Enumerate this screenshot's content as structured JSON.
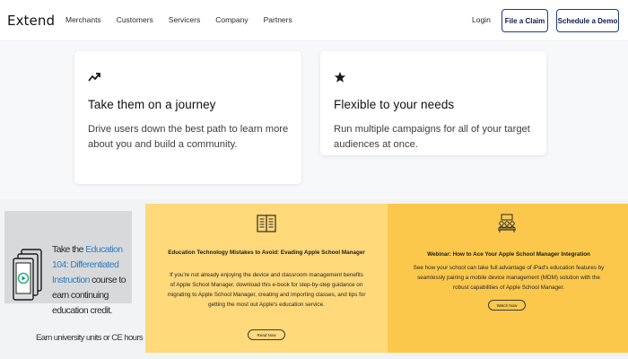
{
  "header": {
    "logo": "Extend",
    "nav": [
      "Merchants",
      "Customers",
      "Servicers",
      "Company",
      "Partners"
    ],
    "login": "Login",
    "file_claim": "File a Claim",
    "schedule_demo": "Schedule a Demo"
  },
  "cards": [
    {
      "icon": "trending-up-icon",
      "title": "Take them on a journey",
      "body": "Drive users down the best path to learn more about you and build a community."
    },
    {
      "icon": "star-icon",
      "title": "Flexible to your needs",
      "body": "Run multiple campaigns for all of your target audiences at once."
    }
  ],
  "promo": {
    "prefix": "Take the ",
    "highlight": "Education 104: Differentiated Instruction",
    "suffix": " course to earn continuing education credit.",
    "credits": "Earn university units or CE hours"
  },
  "panels": [
    {
      "icon": "book-icon",
      "title": "Education Technology Mistakes to Avoid: Evading Apple School Manager",
      "body": "If you're not already enjoying the device and classroom management benefits of Apple School Manager, download this e-book for step-by-step guidance on migrating to Apple School Manager, creating and importing classes, and tips for getting the most out Apple's education service.",
      "button": "Read Now"
    },
    {
      "icon": "classroom-icon",
      "title": "Webinar: How to Ace Your Apple School Manager Integration",
      "body": "See how your school can take full advantage of iPad's education features by seamlessly pairing a mobile device management (MDM) solution with the robust capabilities of Apple School Manager.",
      "button": "Watch Now"
    }
  ],
  "colors": {
    "brand_navy": "#1f3a8a",
    "panel_light": "#ffd97a",
    "panel_dark": "#fbc84c",
    "link_blue": "#2f7fbf"
  }
}
